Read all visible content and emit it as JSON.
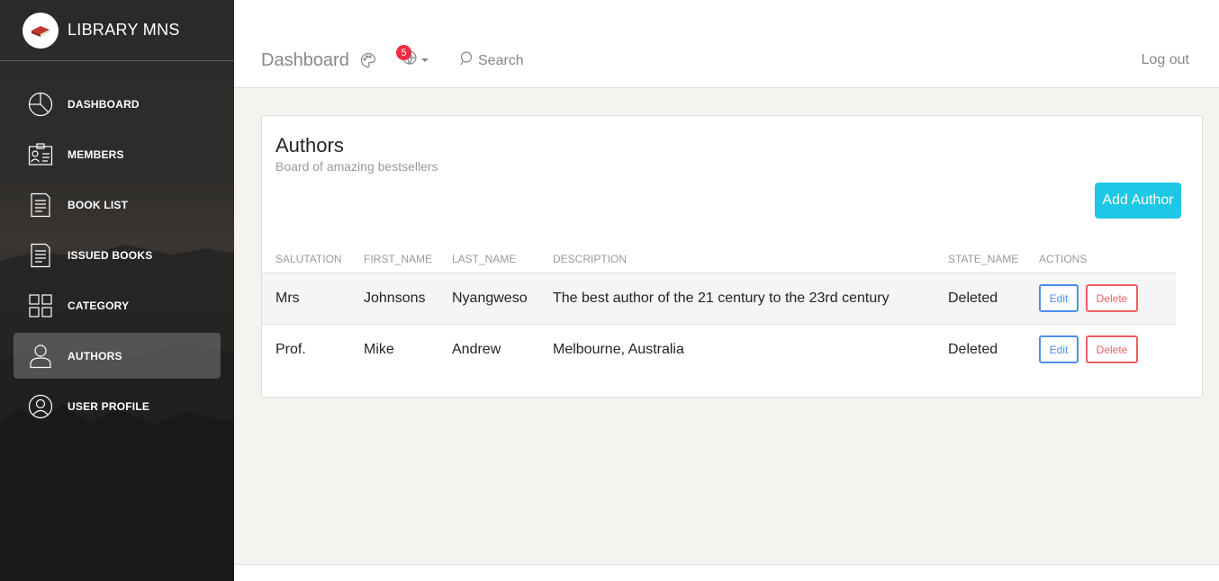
{
  "brand": {
    "name": "LIBRARY MNS",
    "logo_icon": "book-icon"
  },
  "sidebar": {
    "items": [
      {
        "label": "DASHBOARD",
        "icon": "pie-chart-icon",
        "active": false
      },
      {
        "label": "MEMBERS",
        "icon": "id-card-icon",
        "active": false
      },
      {
        "label": "BOOK LIST",
        "icon": "document-icon",
        "active": false
      },
      {
        "label": "ISSUED BOOKS",
        "icon": "document-icon",
        "active": false
      },
      {
        "label": "CATEGORY",
        "icon": "grid-icon",
        "active": false
      },
      {
        "label": "AUTHORS",
        "icon": "user-icon",
        "active": true
      },
      {
        "label": "USER PROFILE",
        "icon": "user-circle-icon",
        "active": false
      }
    ]
  },
  "topbar": {
    "title": "Dashboard",
    "notification_count": "5",
    "search_label": "Search",
    "logout_label": "Log out"
  },
  "card": {
    "title": "Authors",
    "subtitle": "Board of amazing bestsellers",
    "add_button": "Add Author"
  },
  "table": {
    "columns": [
      "SALUTATION",
      "FIRST_NAME",
      "LAST_NAME",
      "DESCRIPTION",
      "STATE_NAME",
      "ACTIONS"
    ],
    "rows": [
      {
        "salutation": "Mrs",
        "first_name": "Johnsons",
        "last_name": "Nyangweso",
        "description": "The best author of the 21 century to the 23rd century",
        "state_name": "Deleted",
        "edit": "Edit",
        "delete": "Delete"
      },
      {
        "salutation": "Prof.",
        "first_name": "Mike",
        "last_name": "Andrew",
        "description": "Melbourne, Australia",
        "state_name": "Deleted",
        "edit": "Edit",
        "delete": "Delete"
      }
    ]
  },
  "colors": {
    "accent_info": "#1ec7e6",
    "edit_blue": "#4d8eee",
    "delete_red": "#ef5f63",
    "badge_red": "#ee2d41"
  }
}
